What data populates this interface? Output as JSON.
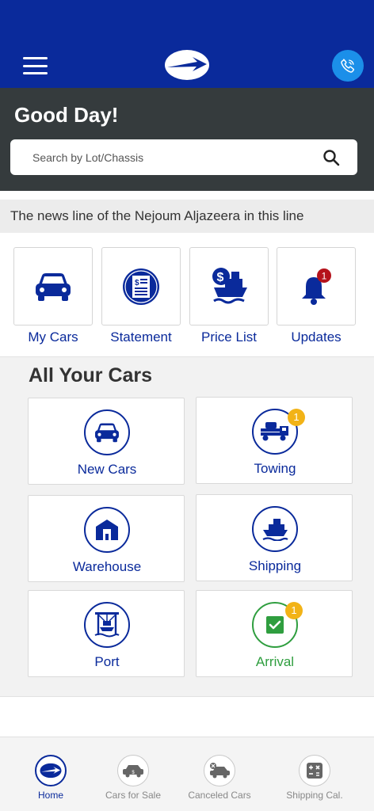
{
  "header": {
    "greeting": "Good Day!",
    "search": {
      "placeholder": "Search by Lot/Chassis"
    }
  },
  "news_line": "The news line of the Nejoum Aljazeera in this line",
  "quick_actions": [
    {
      "label": "My Cars",
      "icon": "car-icon"
    },
    {
      "label": "Statement",
      "icon": "statement-icon"
    },
    {
      "label": "Price List",
      "icon": "price-list-icon"
    },
    {
      "label": "Updates",
      "icon": "bell-icon",
      "badge": "1"
    }
  ],
  "cars_section": {
    "title": "All Your Cars",
    "items": [
      {
        "label": "New Cars",
        "icon": "car-icon"
      },
      {
        "label": "Towing",
        "icon": "tow-truck-icon",
        "badge": "1"
      },
      {
        "label": "Warehouse",
        "icon": "warehouse-icon"
      },
      {
        "label": "Shipping",
        "icon": "ship-icon"
      },
      {
        "label": "Port",
        "icon": "port-crane-icon"
      },
      {
        "label": "Arrival",
        "icon": "checkbox-icon",
        "badge": "1"
      }
    ]
  },
  "bottom_nav": [
    {
      "label": "Home",
      "icon": "home-logo-icon",
      "active": true
    },
    {
      "label": "Cars for Sale",
      "icon": "car-sale-icon"
    },
    {
      "label": "Canceled Cars",
      "icon": "canceled-car-icon"
    },
    {
      "label": "Shipping Cal.",
      "icon": "calculator-icon"
    }
  ],
  "colors": {
    "brand_blue": "#0a2a9b",
    "call_blue": "#1b8fe9",
    "header_dark": "#353b3d",
    "badge_red": "#b5121b",
    "badge_yellow": "#f2b317",
    "arrival_green": "#2f9e3f"
  }
}
